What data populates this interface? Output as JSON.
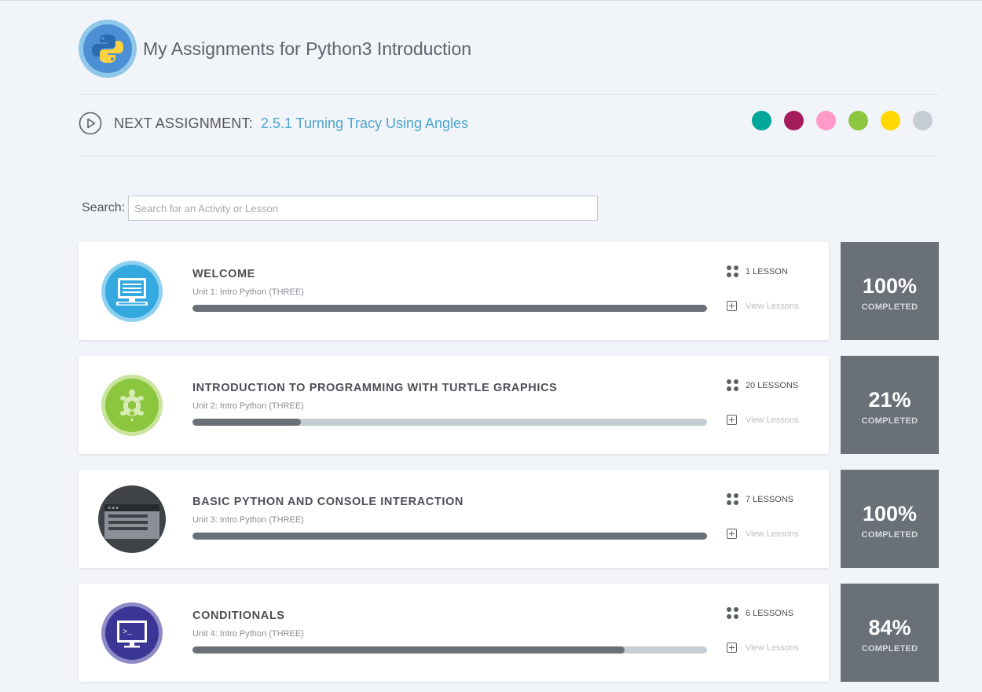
{
  "page": {
    "title": "My Assignments for Python3 Introduction",
    "logo_icon": "python-logo-icon"
  },
  "next_assignment": {
    "label": "NEXT ASSIGNMENT:",
    "link_text": "2.5.1 Turning Tracy Using Angles",
    "icon": "play-circle-icon"
  },
  "theme_swatches": [
    {
      "name": "teal",
      "color": "#00a699"
    },
    {
      "name": "maroon",
      "color": "#a51c5a"
    },
    {
      "name": "pink",
      "color": "#ff9ac8"
    },
    {
      "name": "green",
      "color": "#8cc63f"
    },
    {
      "name": "yellow",
      "color": "#ffd800"
    },
    {
      "name": "gray",
      "color": "#c4cdd3"
    }
  ],
  "search": {
    "label": "Search:",
    "placeholder": "Search for an Activity or Lesson",
    "value": ""
  },
  "units": [
    {
      "title": "WELCOME",
      "subtitle": "Unit 1: Intro Python (THREE)",
      "lessons": "1 LESSON",
      "view_label": "View Lessons",
      "percent_text": "100%",
      "percent_value": 100,
      "completed_label": "COMPLETED",
      "icon": "monitor-icon",
      "icon_color": "#33a9e0"
    },
    {
      "title": "INTRODUCTION TO PROGRAMMING WITH TURTLE GRAPHICS",
      "subtitle": "Unit 2: Intro Python (THREE)",
      "lessons": "20 LESSONS",
      "view_label": "View Lessons",
      "percent_text": "21%",
      "percent_value": 21,
      "completed_label": "COMPLETED",
      "icon": "turtle-icon",
      "icon_color": "#8cc63f"
    },
    {
      "title": "BASIC PYTHON AND CONSOLE INTERACTION",
      "subtitle": "Unit 3: Intro Python (THREE)",
      "lessons": "7 LESSONS",
      "view_label": "View Lessons",
      "percent_text": "100%",
      "percent_value": 100,
      "completed_label": "COMPLETED",
      "icon": "console-window-icon",
      "icon_color": "#3f4247"
    },
    {
      "title": "CONDITIONALS",
      "subtitle": "Unit 4: Intro Python (THREE)",
      "lessons": "6 LESSONS",
      "view_label": "View Lessons",
      "percent_text": "84%",
      "percent_value": 84,
      "completed_label": "COMPLETED",
      "icon": "terminal-monitor-icon",
      "icon_color": "#3b3596"
    }
  ]
}
